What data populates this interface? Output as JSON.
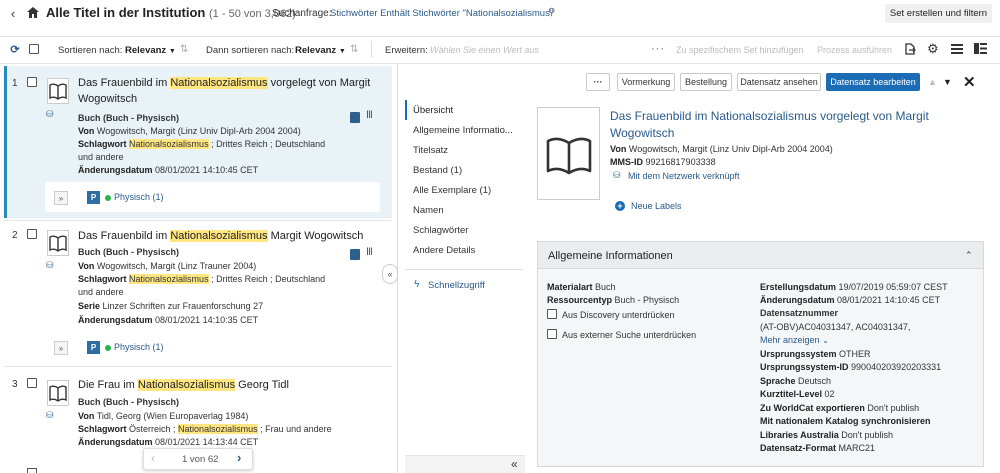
{
  "header": {
    "title": "Alle Titel in der Institution",
    "range": "(1 - 50 von 3,062)",
    "query_label": "Suchanfrage:",
    "query_text": "Stichwörter Enthält Stichwörter \"Nationalsozialismus\"",
    "set_button": "Set erstellen und filtern"
  },
  "toolbar": {
    "sort_label": "Sortieren nach:",
    "sort_value": "Relevanz",
    "then_label": "Dann sortieren nach:",
    "then_value": "Relevanz",
    "expand_label": "Erweitern:",
    "expand_placeholder": "Wählen Sie einen Wert aus",
    "add_to_set": "Zu spezifischem Set hinzufügen",
    "run_process": "Prozess ausführen"
  },
  "results": [
    {
      "num": "1",
      "title_pre": "Das Frauenbild im ",
      "title_hl": "Nationalsozialismus",
      "title_post": " vorgelegt von Margit",
      "title_line2": "Wogowitsch",
      "type": "Buch (Buch - Physisch)",
      "by_label": "Von",
      "by": "Wogowitsch, Margit (Linz Univ Dipl-Arb 2004 2004)",
      "kw_label": "Schlagwort",
      "kw_hl": "Nationalsozialismus",
      "kw_rest": " ; Drittes Reich ; Deutschland",
      "kw_line2": "und andere",
      "date_label": "Änderungsdatum",
      "date": "08/01/2021 14:10:45 CET",
      "avail_badge": "P",
      "avail_text": "Physisch (1)"
    },
    {
      "num": "2",
      "title_pre": "Das Frauenbild im ",
      "title_hl": "Nationalsozialismus",
      "title_post": " Margit Wogowitsch",
      "type": "Buch (Buch - Physisch)",
      "by_label": "Von",
      "by": "Wogowitsch, Margit (Linz Trauner 2004)",
      "kw_label": "Schlagwort",
      "kw_hl": "Nationalsozialismus",
      "kw_rest": " ; Drittes Reich ; Deutschland",
      "kw_line2": "und andere",
      "series_label": "Serie",
      "series": "Linzer Schriften zur Frauenforschung 27",
      "date_label": "Änderungsdatum",
      "date": "08/01/2021 14:10:35 CET",
      "avail_badge": "P",
      "avail_text": "Physisch (1)"
    },
    {
      "num": "3",
      "title_pre": "Die Frau im ",
      "title_hl": "Nationalsozialismus",
      "title_post": " Georg Tidl",
      "type": "Buch (Buch - Physisch)",
      "by_label": "Von",
      "by": "Tidl, Georg (Wien Europaverlag 1984)",
      "kw_label": "Schlagwort",
      "kw_pre": "Österreich ; ",
      "kw_hl": "Nationalsozialismus",
      "kw_rest": " ; Frau und andere",
      "date_label": "Änderungsdatum",
      "date": "08/01/2021 14:13:44 CET"
    }
  ],
  "pager": {
    "text": "1 von 62"
  },
  "detail_toolbar": {
    "more": "···",
    "reserve": "Vormerkung",
    "order": "Bestellung",
    "view": "Datensatz ansehen",
    "edit": "Datensatz bearbeiten"
  },
  "side_nav": {
    "items": [
      "Übersicht",
      "Allgemeine Informatio...",
      "Titelsatz",
      "Bestand (1)",
      "Alle Exemplare (1)",
      "Namen",
      "Schlagwörter",
      "Andere Details"
    ],
    "quick": "Schnellzugriff"
  },
  "record": {
    "title_line1": "Das Frauenbild im Nationalsozialismus vorgelegt von Margit",
    "title_line2": "Wogowitsch",
    "by_label": "Von",
    "by": "Wogowitsch, Margit (Linz Univ Dipl-Arb 2004 2004)",
    "mms_label": "MMS-ID",
    "mms": "99216817903338",
    "network": "Mit dem Netzwerk verknüpft",
    "new_labels": "Neue Labels"
  },
  "general": {
    "heading": "Allgemeine Informationen",
    "left": [
      {
        "label": "Materialart",
        "value": "Buch"
      },
      {
        "label": "Ressourcentyp",
        "value": "Buch - Physisch"
      }
    ],
    "discovery": "Aus Discovery unterdrücken",
    "external": "Aus externer Suche unterdrücken",
    "created_label": "Erstellungsdatum",
    "created": "19/07/2019 05:59:07 CEST",
    "changed_label": "Änderungsdatum",
    "changed": "08/01/2021 14:10:45 CET",
    "recnum_label": "Datensatznummer",
    "recnum": "(AT-OBV)AC04031347, AC04031347,",
    "more": "Mehr anzeigen",
    "rows": [
      {
        "label": "Ursprungssystem",
        "value": "OTHER"
      },
      {
        "label": "Ursprungssystem-ID",
        "value": "990040203920203331"
      },
      {
        "label": "Sprache",
        "value": "Deutsch"
      },
      {
        "label": "Kurztitel-Level",
        "value": "02"
      },
      {
        "label": "Zu WorldCat exportieren",
        "value": "Don't publish"
      },
      {
        "label": "Mit nationalem Katalog synchronisieren",
        "value": ""
      },
      {
        "label": "Libraries Australia",
        "value": "Don't publish"
      },
      {
        "label": "Datensatz-Format",
        "value": "MARC21"
      }
    ]
  },
  "colors": {
    "accent": "#1c6bb5",
    "highlight": "#ffe680",
    "selected_bg": "#e8f2f7",
    "link": "#2a5a8c"
  }
}
